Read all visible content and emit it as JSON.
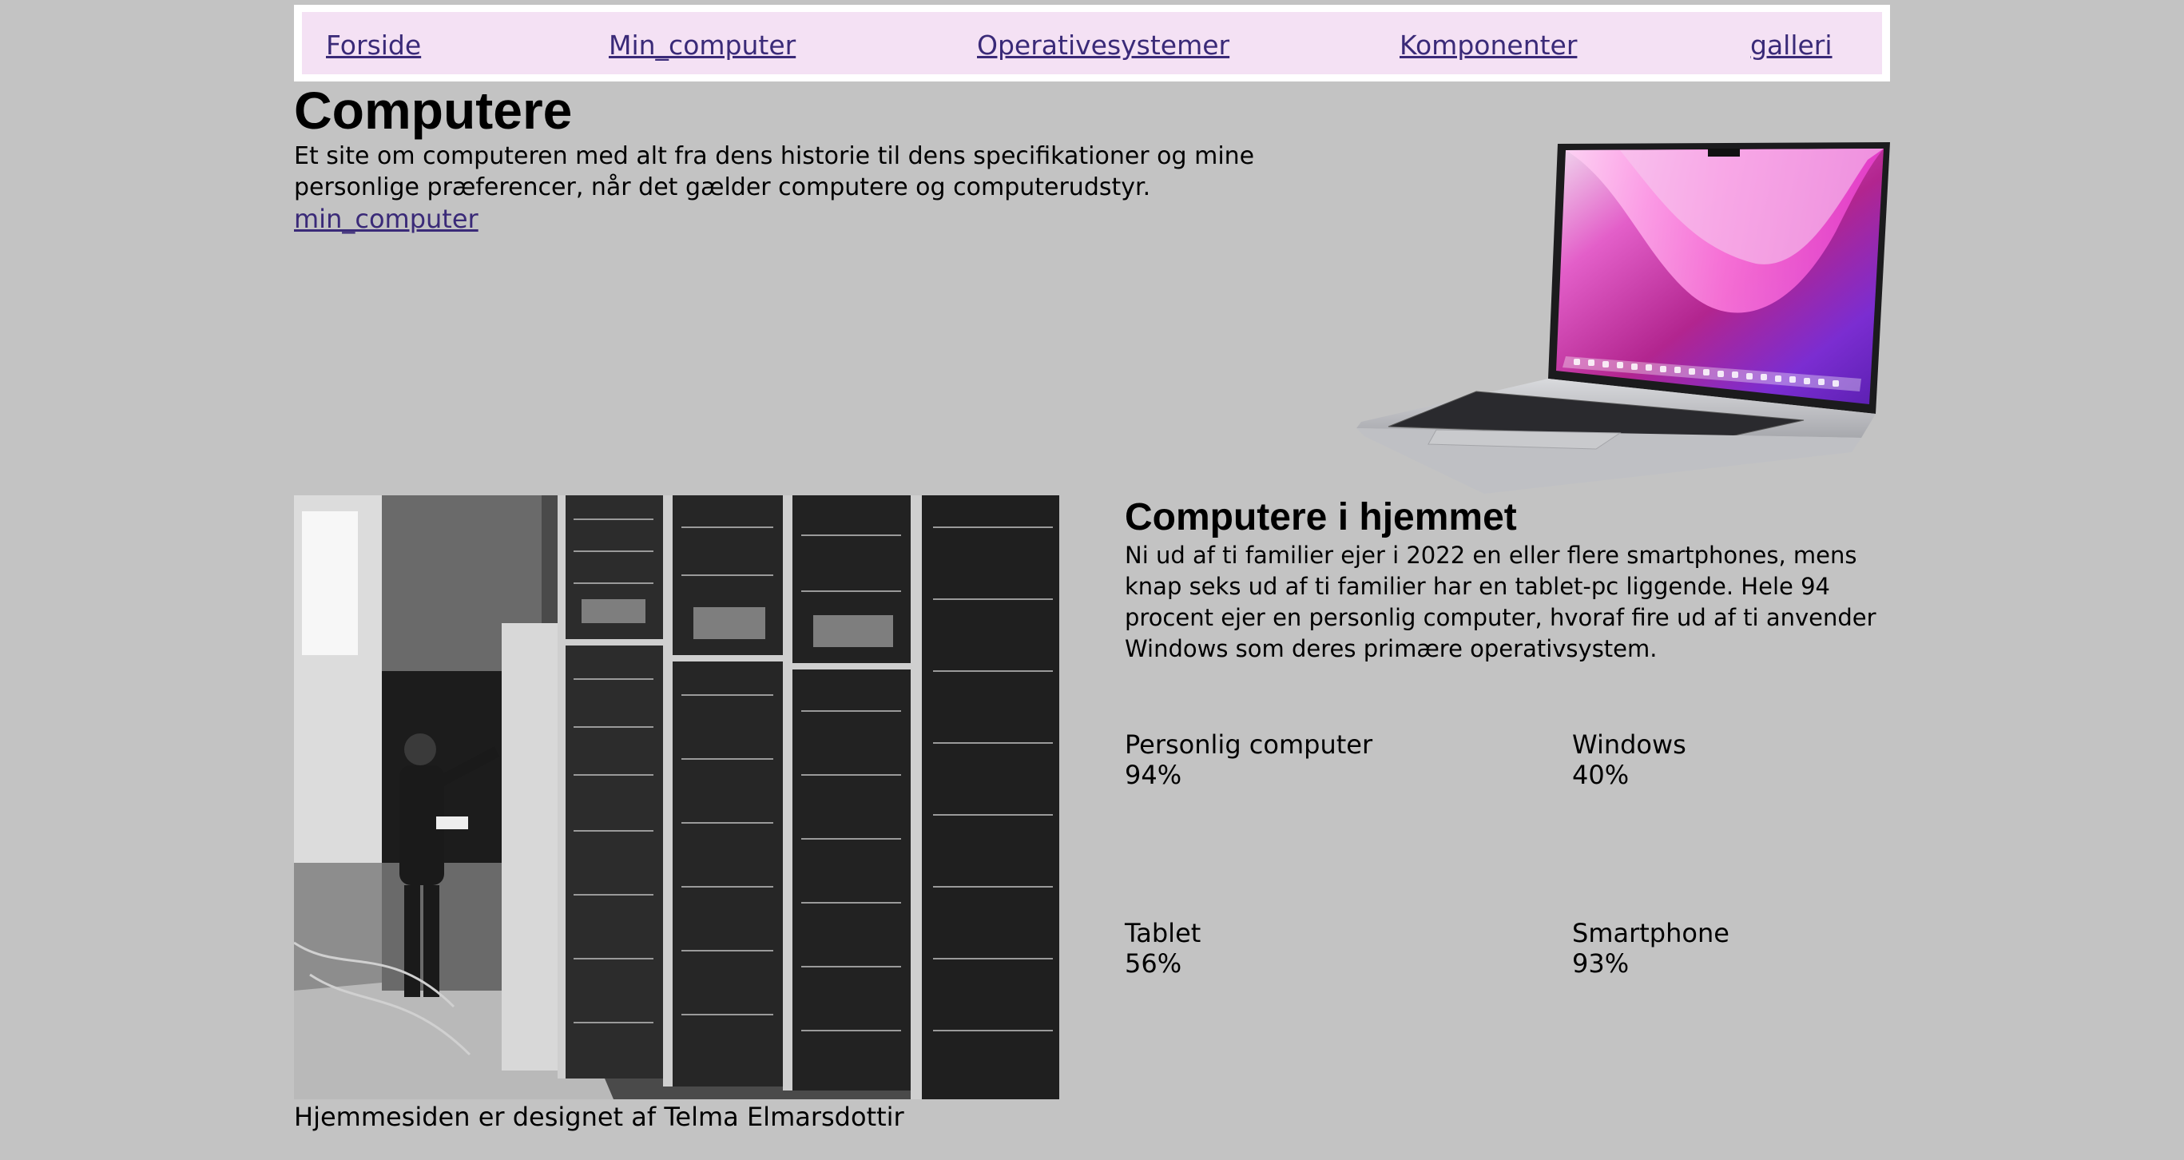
{
  "nav": {
    "items": [
      "Forside",
      "Min_computer",
      "Operativesystemer",
      "Komponenter",
      "galleri"
    ]
  },
  "hero": {
    "title": "Computere",
    "intro": "Et site om computeren med alt fra dens historie til dens specifikationer og mine personlige præferencer, når det gælder computere og computerudstyr.",
    "link": "min_computer"
  },
  "home": {
    "title": "Computere i hjemmet",
    "text": "Ni ud af ti familier ejer i 2022 en eller flere smartphones, mens knap seks ud af ti familier har en tablet-pc liggende. Hele 94 procent ejer en personlig computer, hvoraf fire ud af ti anvender Windows som deres primære operativsystem.",
    "stats": [
      {
        "label": "Personlig computer",
        "value": "94%"
      },
      {
        "label": "Windows",
        "value": "40%"
      },
      {
        "label": "Tablet",
        "value": "56%"
      },
      {
        "label": "Smartphone",
        "value": "93%"
      }
    ]
  },
  "footer": {
    "text": "Hjemmesiden er designet af Telma Elmarsdottir"
  },
  "colors": {
    "background": "#c3c3c3",
    "nav_bg": "#f4e1f4",
    "link": "#3a2a78"
  }
}
